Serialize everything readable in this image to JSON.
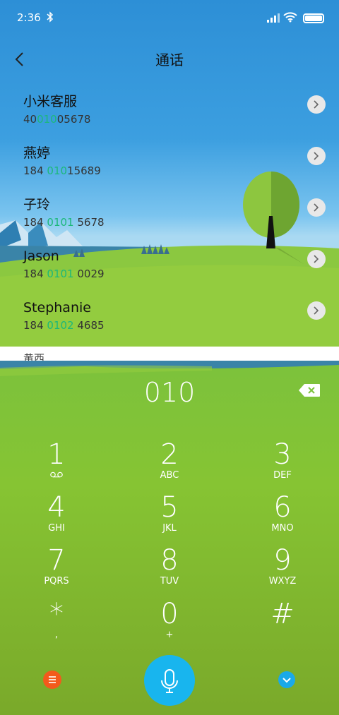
{
  "status_bar": {
    "time": "2:36"
  },
  "header": {
    "title": "通话"
  },
  "contacts": [
    {
      "name": "小米客服",
      "num_pre": "40",
      "num_match": "010",
      "num_post": "05678"
    },
    {
      "name": "燕婷",
      "num_pre": "184 ",
      "num_match": "010",
      "num_post": "15689"
    },
    {
      "name": "子玲",
      "num_pre": "184 ",
      "num_match": "0101",
      "num_post": " 5678"
    },
    {
      "name": "Jason",
      "num_pre": "184 ",
      "num_match": "0101",
      "num_post": " 0029"
    },
    {
      "name": "Stephanie",
      "num_pre": "184 ",
      "num_match": "0102",
      "num_post": " 4685"
    }
  ],
  "partial_contact": {
    "name": "黄西"
  },
  "dialer": {
    "entry": "010",
    "keys": [
      {
        "digit": "1",
        "letters": ""
      },
      {
        "digit": "2",
        "letters": "ABC"
      },
      {
        "digit": "3",
        "letters": "DEF"
      },
      {
        "digit": "4",
        "letters": "GHI"
      },
      {
        "digit": "5",
        "letters": "JKL"
      },
      {
        "digit": "6",
        "letters": "MNO"
      },
      {
        "digit": "7",
        "letters": "PQRS"
      },
      {
        "digit": "8",
        "letters": "TUV"
      },
      {
        "digit": "9",
        "letters": "WXYZ"
      },
      {
        "digit": "*",
        "letters": ","
      },
      {
        "digit": "0",
        "letters": "+"
      },
      {
        "digit": "#",
        "letters": ""
      }
    ]
  },
  "colors": {
    "match_highlight": "#1cb87a",
    "menu_button": "#f35a1c",
    "mic_button": "#18b5ee",
    "collapse_button": "#1aa9e9"
  },
  "icons": [
    "bluetooth-icon",
    "signal-icon",
    "wifi-icon",
    "battery-icon",
    "back-arrow-icon",
    "chevron-right-icon",
    "backspace-icon",
    "voicemail-icon",
    "menu-icon",
    "microphone-icon",
    "chevron-down-icon"
  ]
}
